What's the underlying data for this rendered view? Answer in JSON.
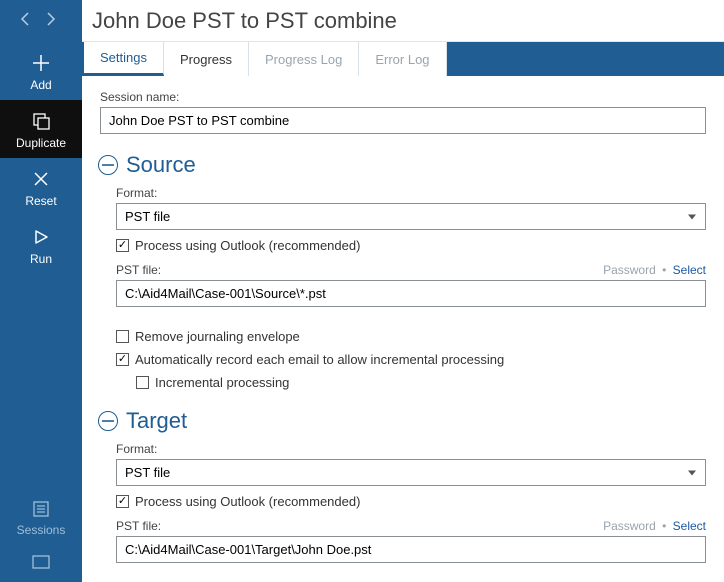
{
  "title": "John Doe PST to PST combine",
  "sidebar": {
    "add": "Add",
    "duplicate": "Duplicate",
    "reset": "Reset",
    "run": "Run",
    "sessions": "Sessions"
  },
  "tabs": {
    "settings": "Settings",
    "progress": "Progress",
    "progress_log": "Progress Log",
    "error_log": "Error Log"
  },
  "session": {
    "label": "Session name:",
    "value": "John Doe PST to PST combine"
  },
  "source": {
    "heading": "Source",
    "format_label": "Format:",
    "format_value": "PST file",
    "process_outlook": "Process using Outlook (recommended)",
    "pst_label": "PST file:",
    "pst_value": "C:\\Aid4Mail\\Case-001\\Source\\*.pst",
    "password_link": "Password",
    "select_link": "Select",
    "remove_journaling": "Remove journaling envelope",
    "auto_record": "Automatically record each email to allow incremental processing",
    "incremental": "Incremental processing"
  },
  "target": {
    "heading": "Target",
    "format_label": "Format:",
    "format_value": "PST file",
    "process_outlook": "Process using Outlook (recommended)",
    "pst_label": "PST file:",
    "pst_value": "C:\\Aid4Mail\\Case-001\\Target\\John Doe.pst",
    "password_link": "Password",
    "select_link": "Select"
  }
}
